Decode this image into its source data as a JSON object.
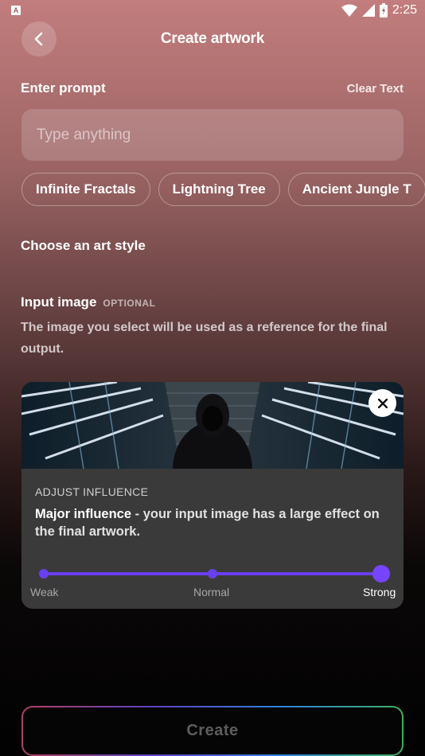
{
  "status": {
    "badge": "A",
    "time": "2:25"
  },
  "header": {
    "title": "Create artwork"
  },
  "prompt": {
    "label": "Enter prompt",
    "clear": "Clear Text",
    "placeholder": "Type anything",
    "value": ""
  },
  "chips": [
    "Infinite Fractals",
    "Lightning Tree",
    "Ancient Jungle T"
  ],
  "art_style": {
    "title": "Choose an art style"
  },
  "input_image": {
    "title": "Input image",
    "optional": "OPTIONAL",
    "description": "The image you select will be used as a reference for the final output."
  },
  "influence": {
    "heading": "ADJUST INFLUENCE",
    "strong_text": "Major influence",
    "rest_text": " - your input image has a large effect on the final artwork.",
    "levels": [
      "Weak",
      "Normal",
      "Strong"
    ],
    "selected": "Strong"
  },
  "create": {
    "label": "Create"
  },
  "colors": {
    "accent": "#6a3ff0"
  }
}
